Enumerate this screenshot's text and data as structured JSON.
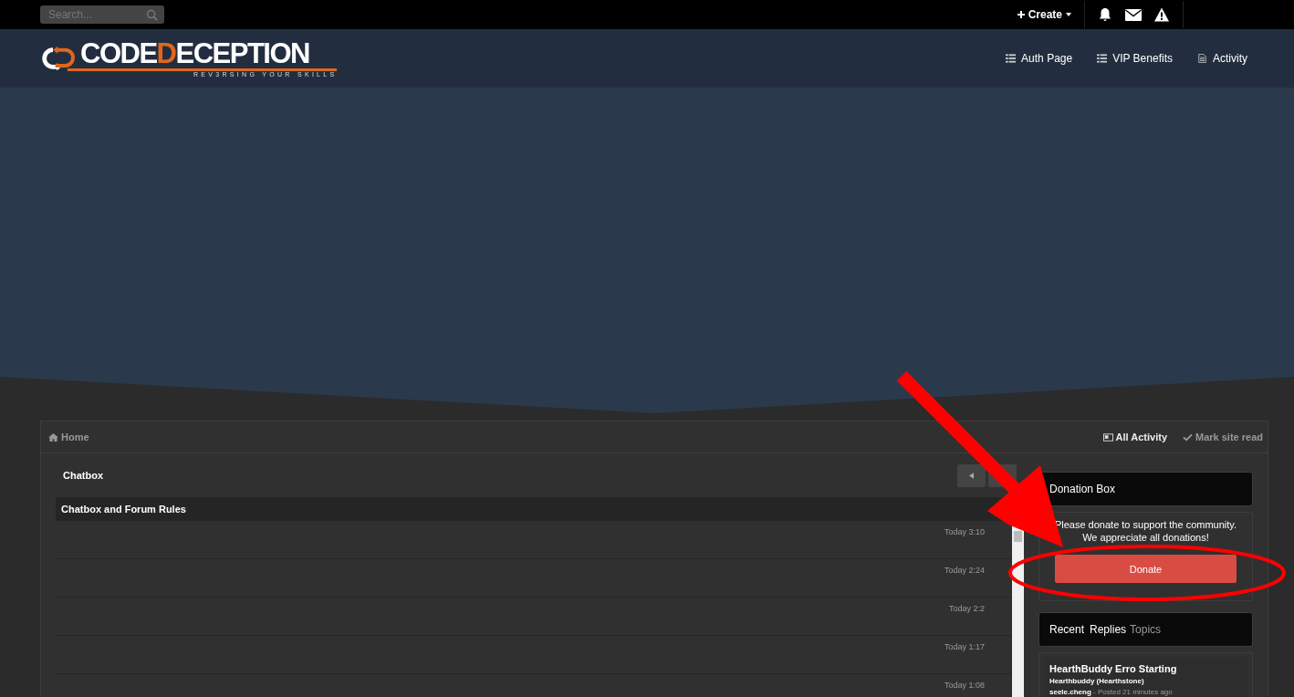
{
  "topbar": {
    "search": {
      "placeholder": "Search..."
    },
    "create": "Create"
  },
  "header": {
    "logo": {
      "parts": [
        {
          "text": "CODE",
          "accent": false
        },
        {
          "text": "D",
          "accent": true
        },
        {
          "text": "ECEPTION",
          "accent": false
        }
      ],
      "tagline": "REV3RSING YOUR SKILLS"
    },
    "nav": [
      {
        "label": "Auth Page",
        "kind": "list"
      },
      {
        "label": "VIP Benefits",
        "kind": "list"
      },
      {
        "label": "Activity",
        "kind": "doc"
      }
    ]
  },
  "breadcrumb": {
    "home": "Home",
    "actions": [
      {
        "label": "All Activity",
        "kind": "activity"
      },
      {
        "label": "Mark site read",
        "kind": "check"
      }
    ]
  },
  "chatbox": {
    "title": "Chatbox",
    "rules": "Chatbox and Forum Rules",
    "messages": [
      {
        "time": "Today 3:10"
      },
      {
        "time": "Today 2:24"
      },
      {
        "time": "Today 2:2"
      },
      {
        "time": "Today 1:17"
      },
      {
        "time": "Today 1:08"
      }
    ]
  },
  "donation": {
    "title": "Donation Box",
    "text": [
      "Please donate to support the community.",
      "We appreciate all donations!"
    ],
    "button": "Donate"
  },
  "recent": {
    "label": "Recent",
    "tabs": [
      {
        "label": "Replies",
        "selected": true
      },
      {
        "label": "Topics",
        "selected": false
      }
    ],
    "topics": [
      {
        "title": "HearthBuddy Erro Starting",
        "forum": "Hearthbuddy (Hearthstone)",
        "author": "seele.cheng",
        "posted": "- Posted 21 minutes ago"
      }
    ]
  }
}
